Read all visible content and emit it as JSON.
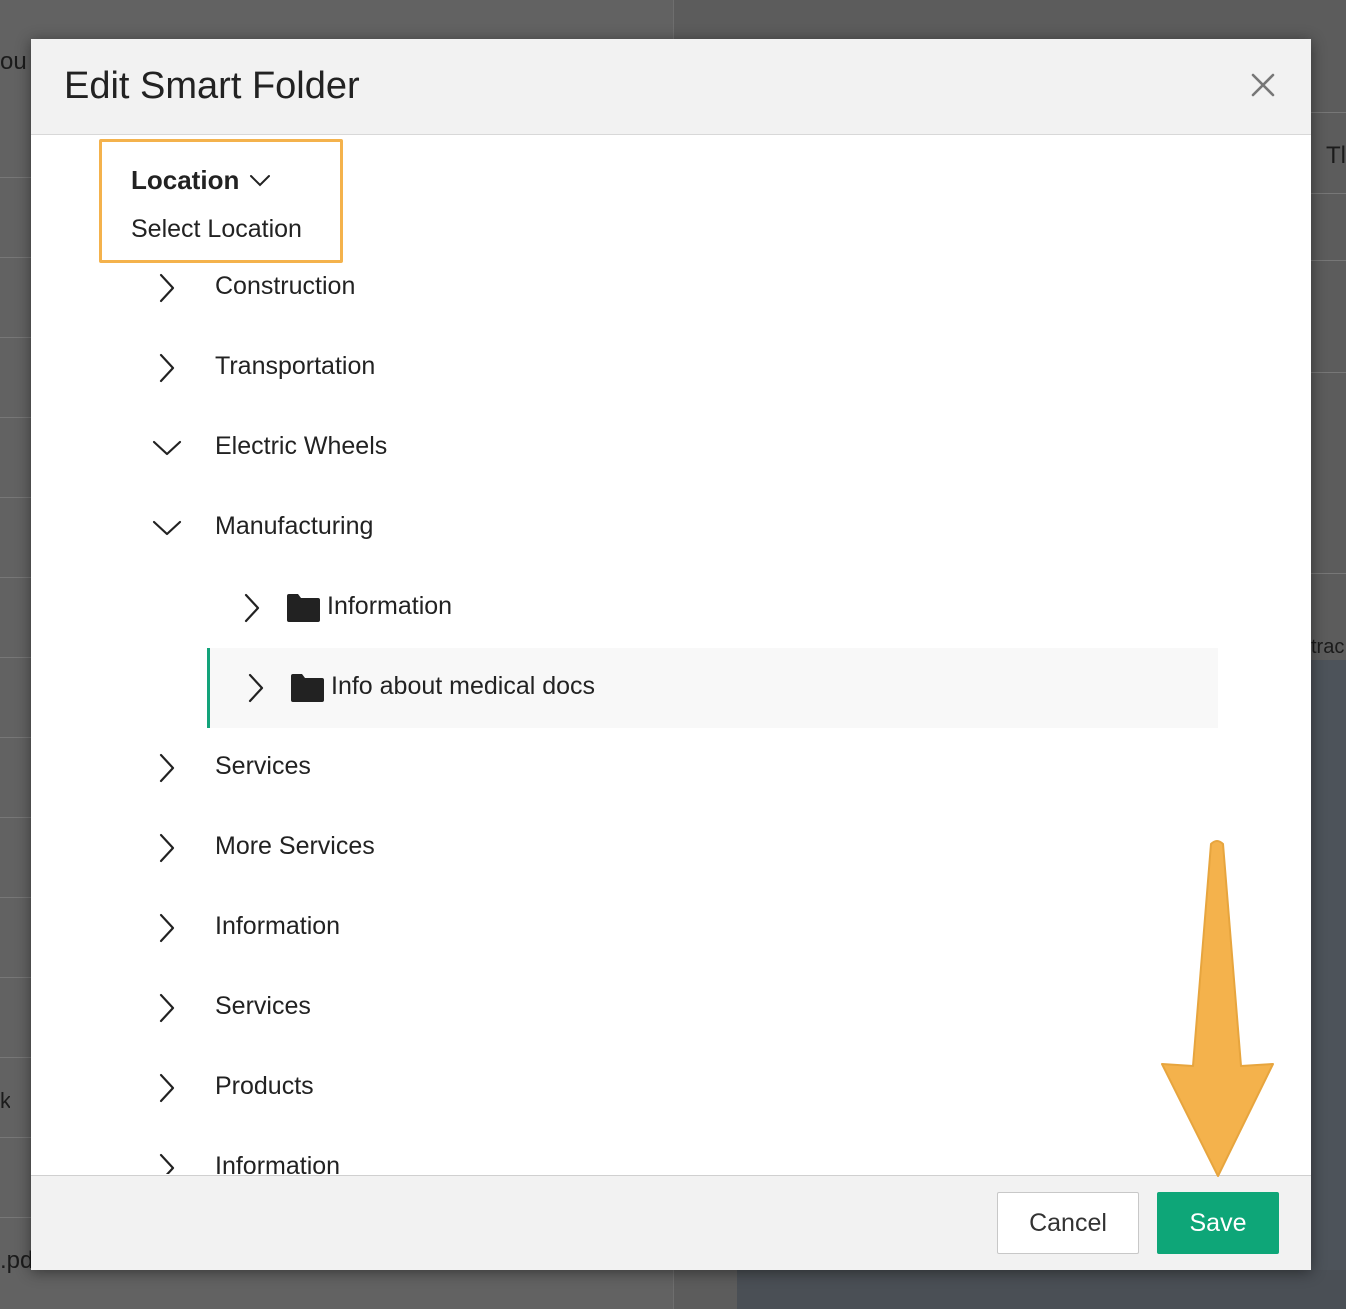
{
  "background": {
    "fragments": [
      "ou",
      "Tl",
      "trac",
      "k",
      ".pd"
    ]
  },
  "modal": {
    "title": "Edit Smart Folder",
    "close_icon": "close-icon",
    "location": {
      "label": "Location",
      "placeholder": "Select Location"
    },
    "tree": [
      {
        "label": "Construction",
        "expanded": false,
        "level": 0,
        "folder": false
      },
      {
        "label": "Transportation",
        "expanded": false,
        "level": 0,
        "folder": false
      },
      {
        "label": "Electric Wheels",
        "expanded": true,
        "level": 0,
        "folder": false
      },
      {
        "label": "Manufacturing",
        "expanded": true,
        "level": 0,
        "folder": false
      },
      {
        "label": "Information",
        "expanded": false,
        "level": 1,
        "folder": true
      },
      {
        "label": "Info about medical docs",
        "expanded": false,
        "level": 1,
        "folder": true,
        "selected": true
      },
      {
        "label": "Services",
        "expanded": false,
        "level": 0,
        "folder": false
      },
      {
        "label": "More Services",
        "expanded": false,
        "level": 0,
        "folder": false
      },
      {
        "label": "Information",
        "expanded": false,
        "level": 0,
        "folder": false
      },
      {
        "label": "Services",
        "expanded": false,
        "level": 0,
        "folder": false
      },
      {
        "label": "Products",
        "expanded": false,
        "level": 0,
        "folder": false
      },
      {
        "label": "Information",
        "expanded": false,
        "level": 0,
        "folder": false
      }
    ],
    "footer": {
      "cancel_label": "Cancel",
      "save_label": "Save"
    }
  },
  "colors": {
    "accent_green": "#0ea678",
    "highlight_orange": "#f4b24c",
    "selected_bar": "#13a37a"
  }
}
